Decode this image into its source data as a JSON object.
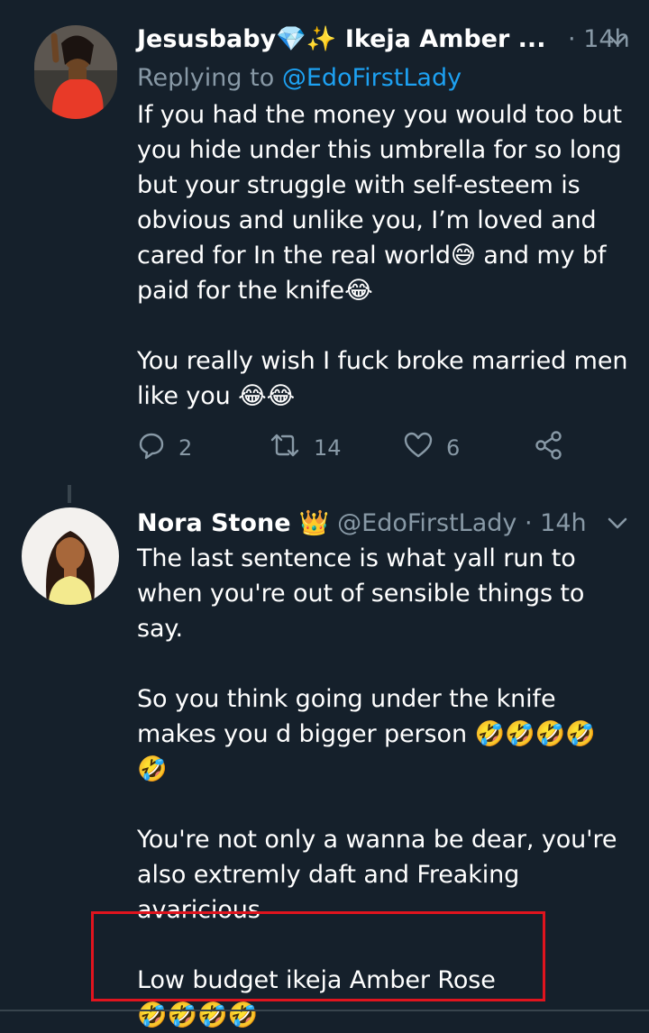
{
  "tweets": [
    {
      "name": "Jesusbaby💎✨ Ikeja Amber ...",
      "dot": "·",
      "time": "14h",
      "replying_prefix": "Replying to",
      "replying_handle": "@EdoFirstLady",
      "lines": [
        "If you had the money you would too but",
        "you hide under this umbrella for so long",
        "but your struggle with self-esteem is",
        "obvious and unlike you, I’m loved and",
        "cared for In the real world😅 and my bf",
        "paid for the knife😂",
        "",
        "You really wish I fuck broke married men",
        "like you 😂😂"
      ],
      "actions": {
        "replies": "2",
        "retweets": "14",
        "likes": "6"
      }
    },
    {
      "name": "Nora Stone 👑",
      "handle": "@EdoFirstLady",
      "dot": "·",
      "time": "14h",
      "lines": [
        "The last sentence is what yall run to",
        "when you're out of sensible things to say.",
        "",
        "So you think going under the knife",
        "makes you d bigger person 🤣🤣🤣🤣",
        "🤣",
        "",
        "You're not only a wanna be dear, you're",
        "also extremly daft and Freaking",
        "avaricious",
        "",
        "Low budget ikeja Amber Rose",
        "🤣🤣🤣🤣"
      ]
    }
  ],
  "icons": {
    "reply": "comment-icon",
    "retweet": "retweet-icon",
    "like": "heart-icon",
    "share": "share-icon",
    "menu": "chevron-down-icon"
  },
  "colors": {
    "background": "#15202b",
    "muted": "#8899a6",
    "link": "#1da1f2",
    "highlight": "#e0141e"
  }
}
